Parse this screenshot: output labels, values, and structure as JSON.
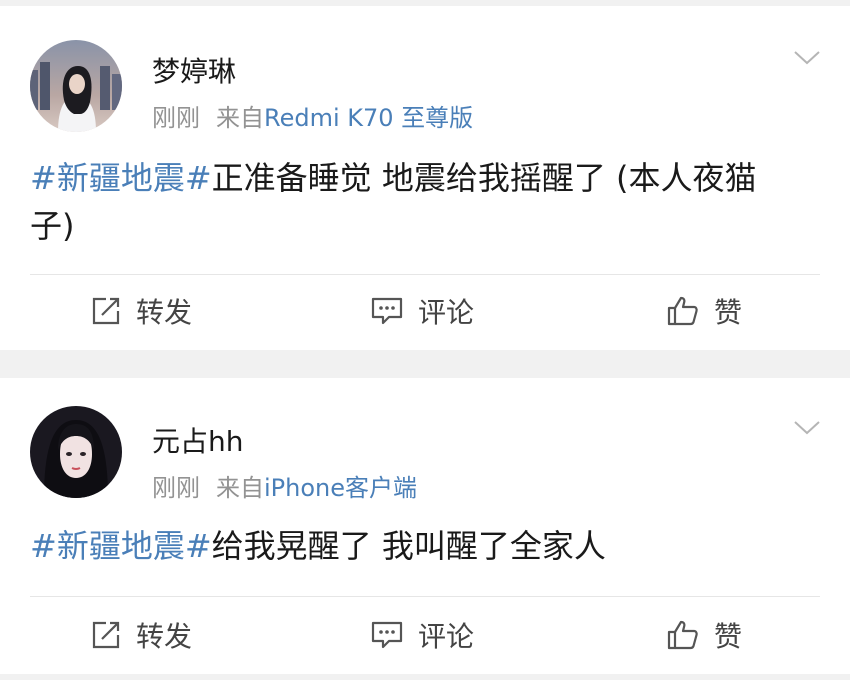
{
  "posts": [
    {
      "username": "梦婷琳",
      "time": "刚刚",
      "source_prefix": "来自",
      "device": "Redmi K70 至尊版",
      "hashtag": "#新疆地震#",
      "text": "正准备睡觉 地震给我摇醒了 (本人夜猫子)",
      "actions": {
        "repost": "转发",
        "comment": "评论",
        "like": "赞"
      }
    },
    {
      "username": "元占hh",
      "time": "刚刚",
      "source_prefix": "来自",
      "device": "iPhone客户端",
      "hashtag": "#新疆地震#",
      "text": "给我晃醒了 我叫醒了全家人",
      "actions": {
        "repost": "转发",
        "comment": "评论",
        "like": "赞"
      }
    }
  ],
  "colors": {
    "link": "#4a7fb8",
    "meta": "#939393",
    "background": "#f1f1f1"
  },
  "icons": [
    "chevron-down-icon",
    "repost-icon",
    "comment-icon",
    "like-icon"
  ]
}
